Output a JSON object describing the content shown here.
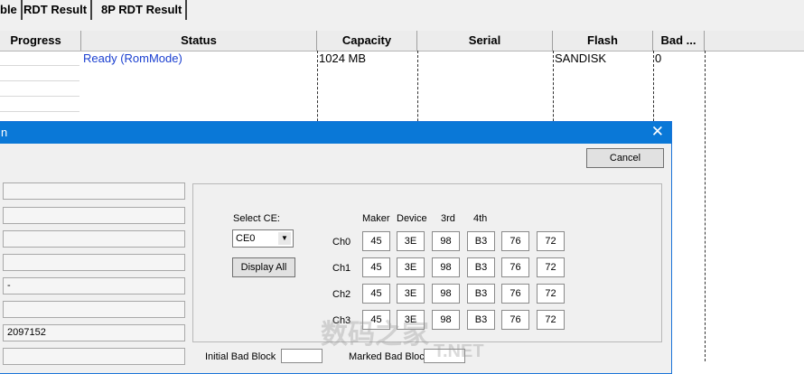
{
  "tabs": [
    {
      "label": "ble"
    },
    {
      "label": "RDT Result"
    },
    {
      "label": "8P RDT Result"
    }
  ],
  "columns": [
    "Progress",
    "Status",
    "Capacity",
    "Serial",
    "Flash",
    "Bad ..."
  ],
  "rows": [
    {
      "status": "Ready (RomMode)",
      "capacity": "1024 MB",
      "serial": "",
      "flash": "SANDISK",
      "bad": "0"
    }
  ],
  "dialog": {
    "title": "n",
    "cancel_label": "Cancel",
    "left_fields": [
      "",
      "",
      "",
      "",
      "-",
      "",
      "2097152",
      ""
    ],
    "select_ce_label": "Select CE:",
    "ce_value": "CE0",
    "display_all_label": "Display All",
    "id_headers": [
      "Maker",
      "Device",
      "3rd",
      "4th"
    ],
    "channels": [
      {
        "name": "Ch0",
        "values": [
          "45",
          "3E",
          "98",
          "B3",
          "76",
          "72"
        ]
      },
      {
        "name": "Ch1",
        "values": [
          "45",
          "3E",
          "98",
          "B3",
          "76",
          "72"
        ]
      },
      {
        "name": "Ch2",
        "values": [
          "45",
          "3E",
          "98",
          "B3",
          "76",
          "72"
        ]
      },
      {
        "name": "Ch3",
        "values": [
          "45",
          "3E",
          "98",
          "B3",
          "76",
          "72"
        ]
      }
    ],
    "initial_bad_block_label": "Initial Bad Block",
    "marked_bad_block_label": "Marked Bad Block"
  },
  "watermark": {
    "text": "数码之家",
    "subtext": "T.NET"
  },
  "colors": {
    "titlebar": "#0a78d7",
    "status_text": "#1a3fd0"
  }
}
